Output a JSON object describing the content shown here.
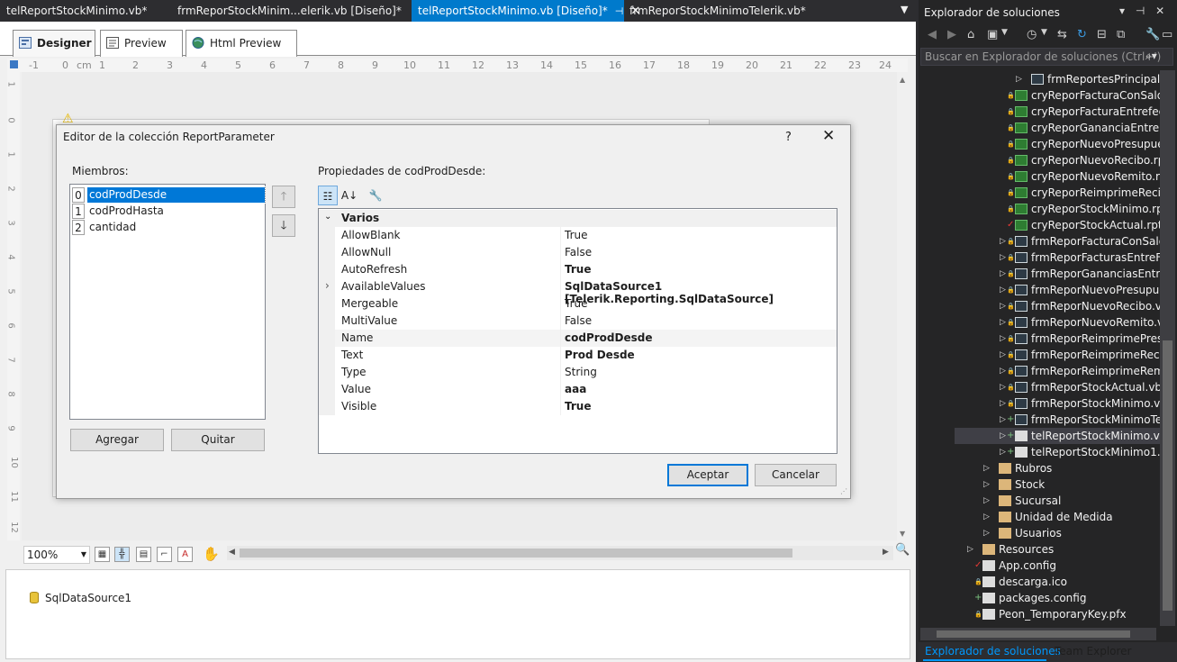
{
  "doc_tabs": [
    {
      "label": "telReportStockMinimo.vb*"
    },
    {
      "label": "frmReporStockMinim...elerik.vb [Diseño]*"
    },
    {
      "label": "telReportStockMinimo.vb [Diseño]*",
      "active": true
    },
    {
      "label": "frmReporStockMinimoTelerik.vb*"
    }
  ],
  "designer_tabs": [
    "Designer",
    "Preview",
    "Html Preview"
  ],
  "ruler": {
    "unit": "cm",
    "numbers": [
      "-1",
      "0",
      "1",
      "2",
      "3",
      "4",
      "5",
      "6",
      "7",
      "8",
      "9",
      "10",
      "11",
      "12",
      "13",
      "14",
      "15",
      "16",
      "17",
      "18",
      "19",
      "20",
      "21",
      "22",
      "23",
      "24"
    ]
  },
  "vruler_numbers": [
    "1",
    "0",
    "1",
    "2",
    "3",
    "4",
    "5",
    "6",
    "7",
    "8",
    "9",
    "10",
    "11",
    "12"
  ],
  "zoom": "100%",
  "components": {
    "item": "SqlDataSource1"
  },
  "dialog": {
    "title": "Editor de la colección ReportParameter",
    "help": "?",
    "members_label": "Miembros:",
    "members": [
      {
        "index": "0",
        "name": "codProdDesde",
        "selected": true
      },
      {
        "index": "1",
        "name": "codProdHasta"
      },
      {
        "index": "2",
        "name": "cantidad"
      }
    ],
    "add_button": "Agregar",
    "remove_button": "Quitar",
    "props_label": "Propiedades de codProdDesde:",
    "category": "Varios",
    "properties": [
      {
        "name": "AllowBlank",
        "value": "True",
        "bold": false
      },
      {
        "name": "AllowNull",
        "value": "False",
        "bold": false
      },
      {
        "name": "AutoRefresh",
        "value": "True",
        "bold": true
      },
      {
        "name": "AvailableValues",
        "value": "SqlDataSource1 [Telerik.Reporting.SqlDataSource]",
        "bold": true,
        "expandable": true
      },
      {
        "name": "Mergeable",
        "value": "True",
        "bold": false
      },
      {
        "name": "MultiValue",
        "value": "False",
        "bold": false
      },
      {
        "name": "Name",
        "value": "codProdDesde",
        "bold": true
      },
      {
        "name": "Text",
        "value": "Prod Desde",
        "bold": true
      },
      {
        "name": "Type",
        "value": "String",
        "bold": false
      },
      {
        "name": "Value",
        "value": "aaa",
        "bold": true
      },
      {
        "name": "Visible",
        "value": "True",
        "bold": true
      }
    ],
    "ok_button": "Aceptar",
    "cancel_button": "Cancelar"
  },
  "solution_explorer": {
    "title": "Explorador de soluciones",
    "search_placeholder": "Buscar en Explorador de soluciones (Ctrl+')",
    "tree": [
      {
        "label": "frmReportesPrincipal.vb",
        "type": "form",
        "indent": 2,
        "arrow": true
      },
      {
        "label": "cryReporFacturaConSaldo.rpt",
        "type": "rpt",
        "indent": 1,
        "mark": "lock"
      },
      {
        "label": "cryReporFacturaEntrefechas.rpt",
        "type": "rpt",
        "indent": 1,
        "mark": "lock"
      },
      {
        "label": "cryReporGananciaEntreFechas.rpt",
        "type": "rpt",
        "indent": 1,
        "mark": "lock"
      },
      {
        "label": "cryReporNuevoPresupuesto.rpt",
        "type": "rpt",
        "indent": 1,
        "mark": "lock"
      },
      {
        "label": "cryReporNuevoRecibo.rpt",
        "type": "rpt",
        "indent": 1,
        "mark": "lock"
      },
      {
        "label": "cryReporNuevoRemito.rpt",
        "type": "rpt",
        "indent": 1,
        "mark": "lock"
      },
      {
        "label": "cryReporReimprimeRecibo.rpt",
        "type": "rpt",
        "indent": 1,
        "mark": "lock"
      },
      {
        "label": "cryReporStockMinimo.rpt",
        "type": "rpt",
        "indent": 1,
        "mark": "lock"
      },
      {
        "label": "cryReporStockActual.rpt",
        "type": "rpt",
        "indent": 1,
        "mark": "check"
      },
      {
        "label": "frmReporFacturaConSaldo.vb",
        "type": "form",
        "indent": 1,
        "arrow": true,
        "mark": "lock"
      },
      {
        "label": "frmReporFacturasEntreFechas.vb",
        "type": "form",
        "indent": 1,
        "arrow": true,
        "mark": "lock"
      },
      {
        "label": "frmReporGananciasEntreFechas.vb",
        "type": "form",
        "indent": 1,
        "arrow": true,
        "mark": "lock"
      },
      {
        "label": "frmReporNuevoPresupuesto.vb",
        "type": "form",
        "indent": 1,
        "arrow": true,
        "mark": "lock"
      },
      {
        "label": "frmReporNuevoRecibo.vb",
        "type": "form",
        "indent": 1,
        "arrow": true,
        "mark": "lock"
      },
      {
        "label": "frmReporNuevoRemito.vb",
        "type": "form",
        "indent": 1,
        "arrow": true,
        "mark": "lock"
      },
      {
        "label": "frmReporReimprimePresupuesto.vb",
        "type": "form",
        "indent": 1,
        "arrow": true,
        "mark": "lock"
      },
      {
        "label": "frmReporReimprimeRecibo.vb",
        "type": "form",
        "indent": 1,
        "arrow": true,
        "mark": "lock"
      },
      {
        "label": "frmReporReimprimeRemito.vb",
        "type": "form",
        "indent": 1,
        "arrow": true,
        "mark": "lock"
      },
      {
        "label": "frmReporStockActual.vb",
        "type": "form",
        "indent": 1,
        "arrow": true,
        "mark": "lock"
      },
      {
        "label": "frmReporStockMinimo.vb",
        "type": "form",
        "indent": 1,
        "arrow": true,
        "mark": "lock"
      },
      {
        "label": "frmReporStockMinimoTelerik.vb",
        "type": "form",
        "indent": 1,
        "arrow": true,
        "mark": "plus"
      },
      {
        "label": "telReportStockMinimo.vb",
        "type": "doc",
        "indent": 1,
        "arrow": true,
        "mark": "plus",
        "selected": true
      },
      {
        "label": "telReportStockMinimo1.vb",
        "type": "doc",
        "indent": 1,
        "arrow": true,
        "mark": "plus"
      },
      {
        "label": "Rubros",
        "type": "folder",
        "indent": 0,
        "arrow": true
      },
      {
        "label": "Stock",
        "type": "folder",
        "indent": 0,
        "arrow": true
      },
      {
        "label": "Sucursal",
        "type": "folder",
        "indent": 0,
        "arrow": true
      },
      {
        "label": "Unidad de Medida",
        "type": "folder",
        "indent": 0,
        "arrow": true
      },
      {
        "label": "Usuarios",
        "type": "folder",
        "indent": 0,
        "arrow": true
      },
      {
        "label": "Resources",
        "type": "folder",
        "indent": -1,
        "arrow": true
      },
      {
        "label": "App.config",
        "type": "doc",
        "indent": -1,
        "mark": "check"
      },
      {
        "label": "descarga.ico",
        "type": "doc",
        "indent": -1,
        "mark": "lock"
      },
      {
        "label": "packages.config",
        "type": "doc",
        "indent": -1,
        "mark": "plus"
      },
      {
        "label": "Peon_TemporaryKey.pfx",
        "type": "doc",
        "indent": -1,
        "mark": "lock"
      }
    ],
    "tabs": [
      {
        "label": "Explorador de soluciones",
        "active": true
      },
      {
        "label": "Team Explorer"
      }
    ]
  },
  "colors": {
    "accent": "#007acc",
    "selection": "#0078d7",
    "dark_bg": "#252526"
  }
}
